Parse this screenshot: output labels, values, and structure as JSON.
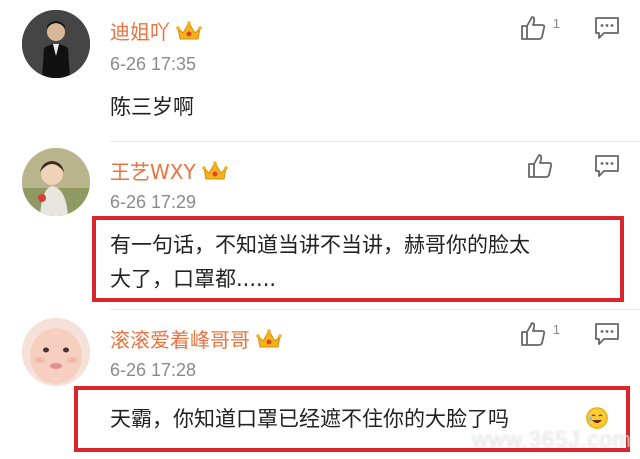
{
  "comments": [
    {
      "username": "迪姐吖",
      "timestamp": "6-26 17:35",
      "text": "陈三岁啊",
      "like_count": "1",
      "avatar": "avatar-man-dark-jacket",
      "badge": "crown-icon"
    },
    {
      "username": "王艺WXY",
      "timestamp": "6-26 17:29",
      "text_line1": "有一句话，不知道当讲不当讲，赫哥你的脸太",
      "text_line2": "大了，口罩都......",
      "like_count": "",
      "avatar": "avatar-girl-outdoor",
      "badge": "crown-icon"
    },
    {
      "username": "滚滚爱着峰哥哥",
      "timestamp": "6-26 17:28",
      "text": "天霸，你知道口罩已经遮不住你的大脸了吗",
      "like_count": "1",
      "avatar": "avatar-baby-face",
      "badge": "crown-icon"
    }
  ],
  "watermark": "www.365J.com",
  "colors": {
    "username": "#eb7340",
    "highlight_border": "#d9262b",
    "timestamp": "#8a8a8a",
    "crown": "#f5b21b"
  }
}
